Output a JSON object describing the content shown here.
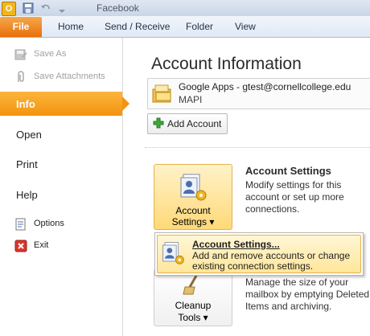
{
  "titlebar": {
    "app_icon_letter": "O",
    "title": "Facebook",
    "quick_access": [
      "save-icon",
      "undo-icon",
      "customize-icon"
    ]
  },
  "tabs": {
    "file": "File",
    "items": [
      "Home",
      "Send / Receive",
      "Folder",
      "View"
    ]
  },
  "nav": {
    "save_as": "Save As",
    "save_attachments": "Save Attachments",
    "info": "Info",
    "open": "Open",
    "print": "Print",
    "help": "Help",
    "options": "Options",
    "exit": "Exit"
  },
  "main": {
    "title": "Account Information",
    "account": {
      "name": "Google Apps - gtest@cornellcollege.edu",
      "type": "MAPI"
    },
    "add_account": "Add Account",
    "account_settings_button": {
      "line1": "Account",
      "line2": "Settings ▾"
    },
    "account_settings_title": "Account Settings",
    "account_settings_desc": "Modify settings for this account or set up more connections.",
    "cleanup_button": {
      "line1": "Cleanup",
      "line2": "Tools ▾"
    },
    "cleanup_desc": "Manage the size of your mailbox by emptying Deleted Items and archiving."
  },
  "menu": {
    "item_title": "Account Settings...",
    "item_desc": "Add and remove accounts or change existing connection settings."
  },
  "colors": {
    "file_tab": "#e86f0a",
    "selected_nav": "#f4930f",
    "highlight": "#ffd978"
  }
}
